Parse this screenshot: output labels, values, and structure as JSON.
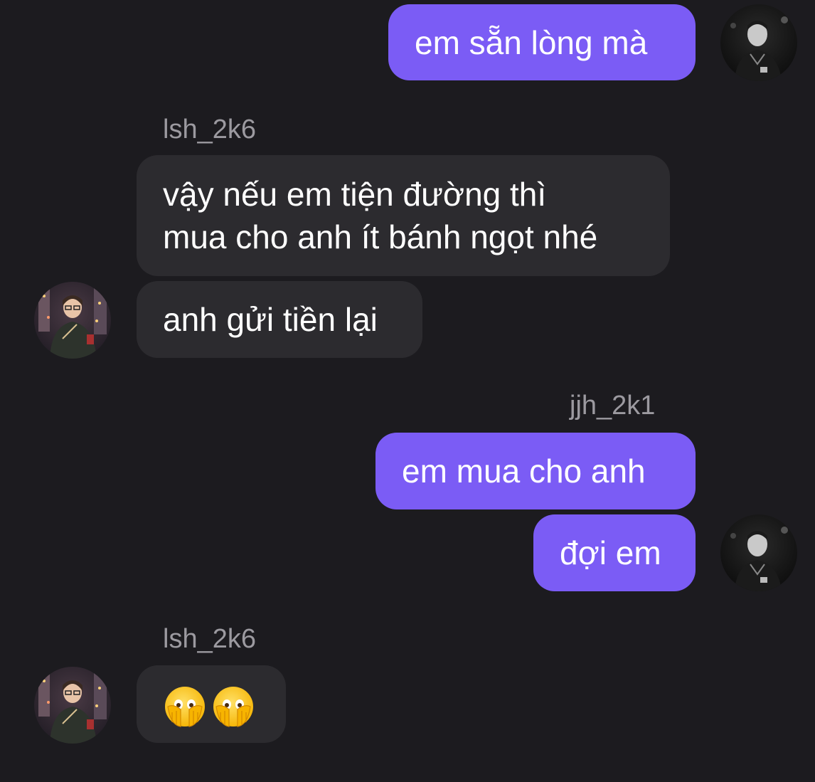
{
  "colors": {
    "background": "#1c1b1f",
    "outgoing_bubble": "#7b5cf5",
    "incoming_bubble": "#2c2b2f",
    "sender_name": "#9c9aa0",
    "text": "#ffffff"
  },
  "messages": [
    {
      "direction": "outgoing",
      "text": "em sẵn lòng mà"
    },
    {
      "direction": "incoming",
      "sender": "lsh_2k6",
      "lines": [
        "vậy nếu em tiện đường thì",
        "mua cho anh ít bánh ngọt nhé"
      ]
    },
    {
      "direction": "incoming",
      "text": "anh gửi tiền lại"
    },
    {
      "direction": "outgoing",
      "sender": "jjh_2k1",
      "text": "em mua cho anh"
    },
    {
      "direction": "outgoing",
      "text": "đợi em"
    },
    {
      "direction": "incoming",
      "sender": "lsh_2k6",
      "emoji": [
        "face-with-hand-over-mouth-eyes-open",
        "face-with-hand-over-mouth-eyes-open"
      ]
    }
  ],
  "avatars": {
    "outgoing": "avatar-jjh_2k1",
    "incoming": "avatar-lsh_2k6"
  }
}
